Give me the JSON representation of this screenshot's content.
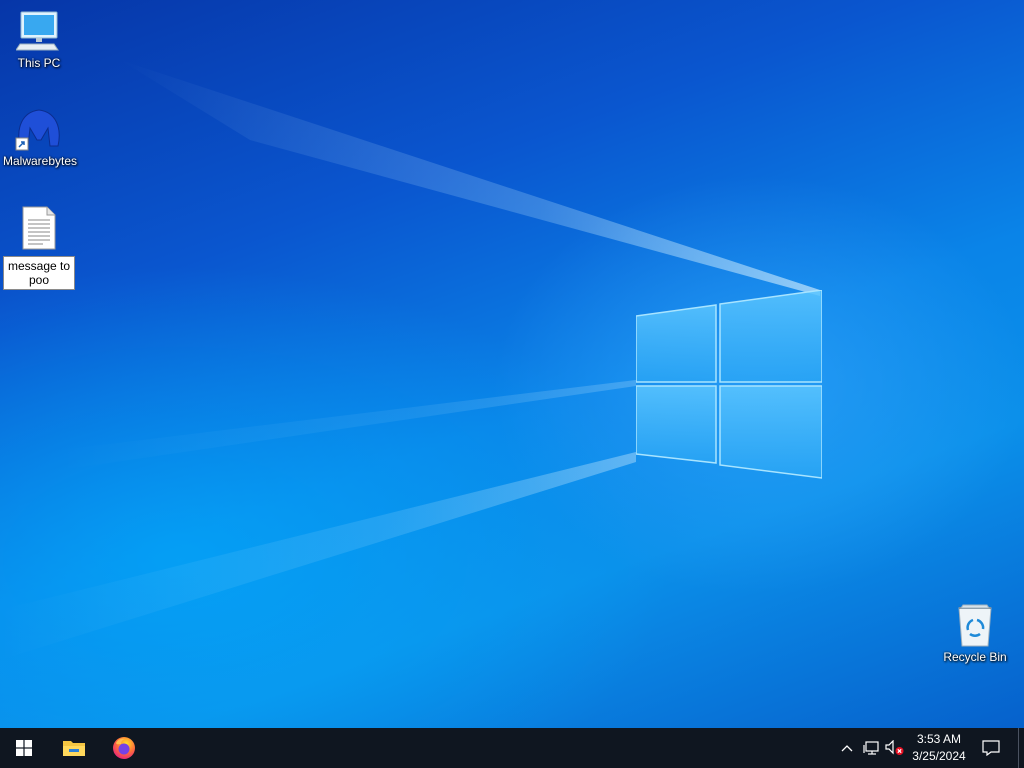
{
  "desktop": {
    "icons": [
      {
        "label": "This PC",
        "icon": "computer-icon"
      },
      {
        "label": "Malwarebytes",
        "icon": "malwarebytes-icon"
      },
      {
        "label": "message to poo",
        "icon": "text-document-icon",
        "selected": true
      },
      {
        "label": "Recycle Bin",
        "icon": "recycle-bin-icon"
      }
    ]
  },
  "taskbar": {
    "start_icon": "windows-start-icon",
    "pinned": [
      {
        "icon": "file-explorer-icon"
      },
      {
        "icon": "firefox-icon"
      }
    ],
    "tray": {
      "icons": [
        "chevron-up-icon",
        "network-icon",
        "volume-muted-icon"
      ],
      "time": "3:53 AM",
      "date": "3/25/2024",
      "notification_icon": "action-center-icon"
    }
  },
  "colors": {
    "taskbar": "#0f1620",
    "desktop_accent": "#0a84e8"
  }
}
